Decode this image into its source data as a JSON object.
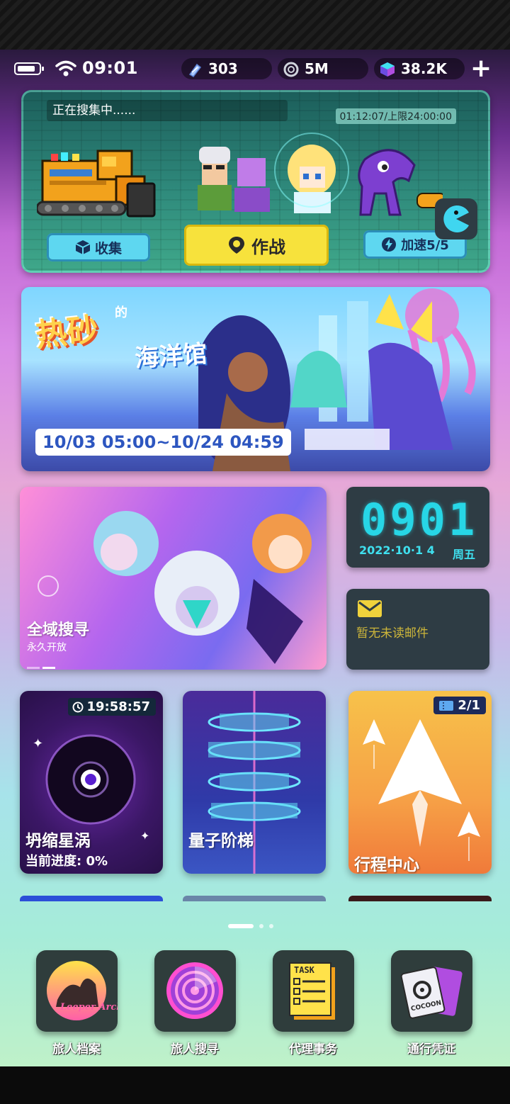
{
  "status_bar": {
    "time": "09:01",
    "resources": [
      {
        "icon": "crystal-shard-icon",
        "value": "303"
      },
      {
        "icon": "coin-ring-icon",
        "value": "5M"
      },
      {
        "icon": "gem-cube-icon",
        "value": "38.2K"
      }
    ]
  },
  "collect_panel": {
    "status_text": "正在搜集中......",
    "timer_text": "01:12:07/上限24:00:00",
    "collect_label": "收集",
    "battle_label": "作战",
    "speedup_label": "加速5/5"
  },
  "event_banner": {
    "title": "热砂",
    "title_small": "的",
    "subtitle": "海洋馆",
    "date_range": "10/03 05:00~10/24 04:59"
  },
  "explore_card": {
    "title": "全域搜寻",
    "subtitle": "永久开放"
  },
  "clock_widget": {
    "time": "0901",
    "date": "2022·10·1 4",
    "weekday": "周五"
  },
  "mail_widget": {
    "text": "暂无未读邮件"
  },
  "feature_cards": [
    {
      "title": "坍缩星涡",
      "timer": "19:58:57",
      "progress": "当前进度:  0%"
    },
    {
      "title": "量子阶梯"
    },
    {
      "title": "行程中心",
      "count": "2/1"
    }
  ],
  "dock": [
    {
      "label": "旅人档案",
      "icon": "leeper-archives-icon",
      "icon_text": "Leeper Archives"
    },
    {
      "label": "旅人搜寻",
      "icon": "radar-icon"
    },
    {
      "label": "代理事务",
      "icon": "task-list-icon",
      "icon_text": "TASK"
    },
    {
      "label": "通行凭证",
      "icon": "cocoon-pass-icon",
      "icon_text": "COCOON"
    }
  ],
  "colors": {
    "accent_cyan": "#27d6e6",
    "battle_yellow": "#f7e23c",
    "mail_yellow": "#f0d23c"
  }
}
